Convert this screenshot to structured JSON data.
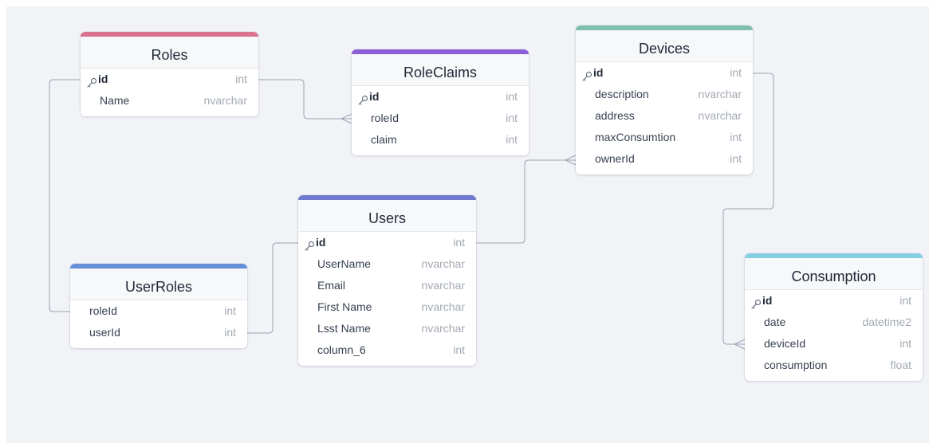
{
  "tables": {
    "roles": {
      "title": "Roles",
      "color": "#d9718f",
      "fields": [
        {
          "name": "id",
          "type": "int",
          "pk": true
        },
        {
          "name": "Name",
          "type": "nvarchar",
          "pk": false
        }
      ]
    },
    "roleclaims": {
      "title": "RoleClaims",
      "color": "#8b5fd8",
      "fields": [
        {
          "name": "id",
          "type": "int",
          "pk": true
        },
        {
          "name": "roleId",
          "type": "int",
          "pk": false
        },
        {
          "name": "claim",
          "type": "int",
          "pk": false
        }
      ]
    },
    "devices": {
      "title": "Devices",
      "color": "#7fbfae",
      "fields": [
        {
          "name": "id",
          "type": "int",
          "pk": true
        },
        {
          "name": "description",
          "type": "nvarchar",
          "pk": false
        },
        {
          "name": "address",
          "type": "nvarchar",
          "pk": false
        },
        {
          "name": "maxConsumtion",
          "type": "int",
          "pk": false
        },
        {
          "name": "ownerId",
          "type": "int",
          "pk": false
        }
      ]
    },
    "users": {
      "title": "Users",
      "color": "#6f79cf",
      "fields": [
        {
          "name": "id",
          "type": "int",
          "pk": true
        },
        {
          "name": "UserName",
          "type": "nvarchar",
          "pk": false
        },
        {
          "name": "Email",
          "type": "nvarchar",
          "pk": false
        },
        {
          "name": "First Name",
          "type": "nvarchar",
          "pk": false
        },
        {
          "name": "Lsst Name",
          "type": "nvarchar",
          "pk": false
        },
        {
          "name": "column_6",
          "type": "int",
          "pk": false
        }
      ]
    },
    "userroles": {
      "title": "UserRoles",
      "color": "#6590d8",
      "fields": [
        {
          "name": "roleId",
          "type": "int",
          "pk": false
        },
        {
          "name": "userId",
          "type": "int",
          "pk": false
        }
      ]
    },
    "consumption": {
      "title": "Consumption",
      "color": "#84d0e2",
      "fields": [
        {
          "name": "id",
          "type": "int",
          "pk": true
        },
        {
          "name": "date",
          "type": "datetime2",
          "pk": false
        },
        {
          "name": "deviceId",
          "type": "int",
          "pk": false
        },
        {
          "name": "consumption",
          "type": "float",
          "pk": false
        }
      ]
    }
  },
  "relationships": [
    {
      "from": "Roles.id",
      "to": "RoleClaims.roleId",
      "cardinality": "one-to-many"
    },
    {
      "from": "Roles.id",
      "to": "UserRoles.roleId",
      "cardinality": "one-to-one"
    },
    {
      "from": "Users.id",
      "to": "UserRoles.userId",
      "cardinality": "one-to-one"
    },
    {
      "from": "Users.id",
      "to": "Devices.ownerId",
      "cardinality": "one-to-many"
    },
    {
      "from": "Devices.id",
      "to": "Consumption.deviceId",
      "cardinality": "one-to-many"
    }
  ],
  "colors": {
    "canvas": "#f1f3f7",
    "link": "#9aa3b2"
  }
}
